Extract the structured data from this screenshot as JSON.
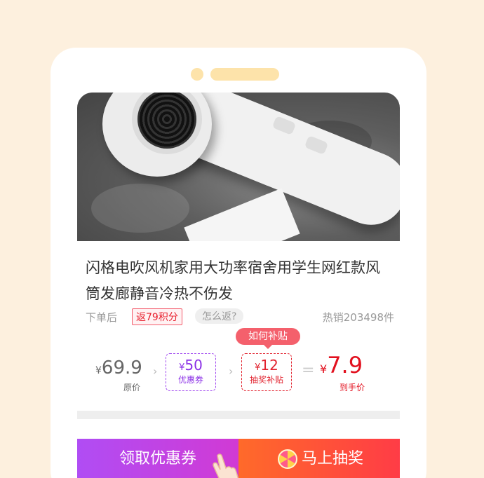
{
  "product": {
    "title": "闪格电吹风机家用大功率宿舍用学生网红款风筒发廊静音冷热不伤发",
    "order_label": "下单后",
    "points_badge": "返79积分",
    "how_label": "怎么返?",
    "sold_text": "热销203498件"
  },
  "pricing": {
    "tooltip": "如何补贴",
    "currency": "¥",
    "original_price": "69.9",
    "original_caption": "原价",
    "coupon_value": "50",
    "coupon_caption": "优惠券",
    "lottery_value": "12",
    "lottery_caption": "抽奖补贴",
    "equals": "=",
    "final_price": "7.9",
    "final_caption": "到手价",
    "chevron": "›"
  },
  "actions": {
    "claim_label": "领取优惠券",
    "draw_label": "马上抽奖"
  },
  "colors": {
    "page_bg": "#fdf0de",
    "accent_red": "#e2101e",
    "coupon_purple": "#8a2ee6",
    "claim_gradient": [
      "#b04df4",
      "#d13ad4"
    ],
    "draw_gradient": [
      "#ff6a2a",
      "#ff3c46"
    ]
  }
}
